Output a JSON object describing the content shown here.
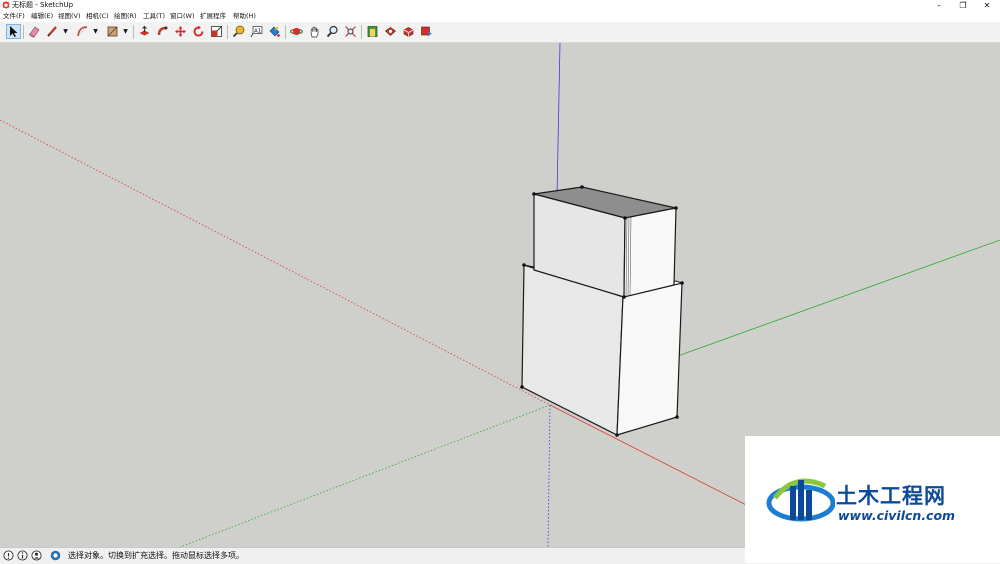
{
  "window": {
    "title": "无标题 - SketchUp",
    "minimize_glyph": "–",
    "maximize_glyph": "❐",
    "close_glyph": "✕"
  },
  "menu": [
    {
      "label": "文件(F)"
    },
    {
      "label": "编辑(E)"
    },
    {
      "label": "视图(V)"
    },
    {
      "label": "相机(C)"
    },
    {
      "label": "绘图(R)"
    },
    {
      "label": "工具(T)"
    },
    {
      "label": "窗口(W)"
    },
    {
      "label": "扩展程序"
    },
    {
      "label": "帮助(H)"
    }
  ],
  "toolbar": {
    "tools": [
      "select-icon",
      "eraser-icon",
      "line-icon",
      "arc-icon",
      "shape-icon",
      "push-pull-icon",
      "follow-me-icon",
      "move-icon",
      "rotate-icon",
      "scale-icon",
      "tape-measure-icon",
      "text-icon",
      "paint-bucket-icon",
      "orbit-icon",
      "pan-icon",
      "zoom-icon",
      "zoom-extents-icon",
      "warehouse-icon",
      "extension-warehouse-icon",
      "components-icon",
      "sandbox-icon"
    ],
    "dropdown_glyph": "▼"
  },
  "axes_colors": {
    "red": "#d23a3a",
    "green": "#2fa82f",
    "blue": "#3b3bd6"
  },
  "status": {
    "message": "选择对象。切换到扩充选择。拖动鼠标选择多项。",
    "icons": [
      "info-icon",
      "credits-icon",
      "user-icon",
      "help-icon"
    ]
  },
  "watermark": {
    "name": "土木工程网",
    "url": "www.civilcn.com"
  }
}
